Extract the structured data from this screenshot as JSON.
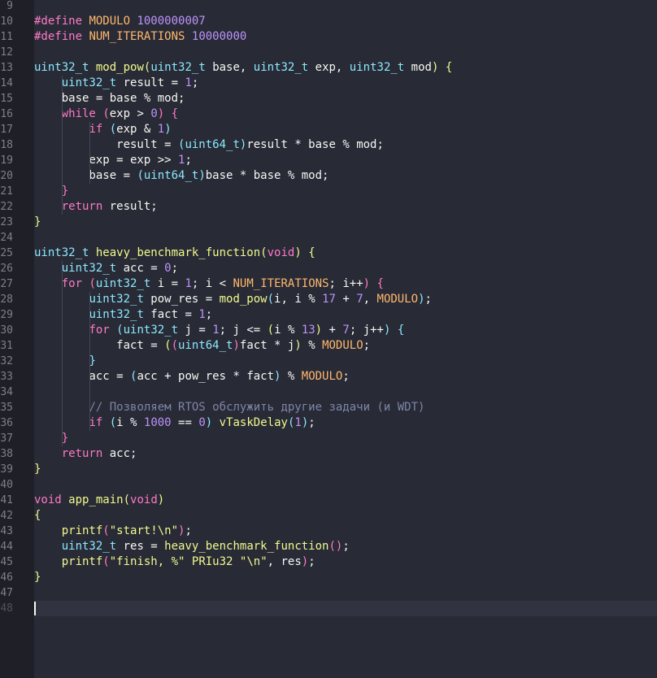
{
  "editor": {
    "lines": [
      {
        "num": "9",
        "tokens": []
      },
      {
        "num": "10",
        "tokens": [
          {
            "c": "t-pre",
            "t": "#define "
          },
          {
            "c": "t-macro",
            "t": "MODULO"
          },
          {
            "c": "t-plain",
            "t": " "
          },
          {
            "c": "t-num",
            "t": "1000000007"
          }
        ]
      },
      {
        "num": "11",
        "tokens": [
          {
            "c": "t-pre",
            "t": "#define "
          },
          {
            "c": "t-macro",
            "t": "NUM_ITERATIONS"
          },
          {
            "c": "t-plain",
            "t": " "
          },
          {
            "c": "t-num",
            "t": "10000000"
          }
        ]
      },
      {
        "num": "12",
        "tokens": []
      },
      {
        "num": "13",
        "tokens": [
          {
            "c": "t-type",
            "t": "uint32_t"
          },
          {
            "c": "t-plain",
            "t": " "
          },
          {
            "c": "t-fn",
            "t": "mod_pow"
          },
          {
            "c": "t-paren1",
            "t": "("
          },
          {
            "c": "t-type",
            "t": "uint32_t"
          },
          {
            "c": "t-plain",
            "t": " base, "
          },
          {
            "c": "t-type",
            "t": "uint32_t"
          },
          {
            "c": "t-plain",
            "t": " exp, "
          },
          {
            "c": "t-type",
            "t": "uint32_t"
          },
          {
            "c": "t-plain",
            "t": " mod"
          },
          {
            "c": "t-paren1",
            "t": ")"
          },
          {
            "c": "t-plain",
            "t": " "
          },
          {
            "c": "t-paren1",
            "t": "{"
          }
        ]
      },
      {
        "num": "14",
        "tokens": [
          {
            "c": "t-plain",
            "t": "    "
          },
          {
            "c": "t-type",
            "t": "uint32_t"
          },
          {
            "c": "t-plain",
            "t": " result = "
          },
          {
            "c": "t-num",
            "t": "1"
          },
          {
            "c": "t-plain",
            "t": ";"
          }
        ]
      },
      {
        "num": "15",
        "tokens": [
          {
            "c": "t-plain",
            "t": "    base = base % mod;"
          }
        ]
      },
      {
        "num": "16",
        "tokens": [
          {
            "c": "t-plain",
            "t": "    "
          },
          {
            "c": "t-kw",
            "t": "while"
          },
          {
            "c": "t-plain",
            "t": " "
          },
          {
            "c": "t-paren2",
            "t": "("
          },
          {
            "c": "t-plain",
            "t": "exp > "
          },
          {
            "c": "t-num",
            "t": "0"
          },
          {
            "c": "t-paren2",
            "t": ")"
          },
          {
            "c": "t-plain",
            "t": " "
          },
          {
            "c": "t-paren2",
            "t": "{"
          }
        ]
      },
      {
        "num": "17",
        "tokens": [
          {
            "c": "t-plain",
            "t": "        "
          },
          {
            "c": "t-kw",
            "t": "if"
          },
          {
            "c": "t-plain",
            "t": " "
          },
          {
            "c": "t-paren3",
            "t": "("
          },
          {
            "c": "t-plain",
            "t": "exp & "
          },
          {
            "c": "t-num",
            "t": "1"
          },
          {
            "c": "t-paren3",
            "t": ")"
          }
        ]
      },
      {
        "num": "18",
        "tokens": [
          {
            "c": "t-plain",
            "t": "            result = "
          },
          {
            "c": "t-paren3",
            "t": "("
          },
          {
            "c": "t-type",
            "t": "uint64_t"
          },
          {
            "c": "t-paren3",
            "t": ")"
          },
          {
            "c": "t-plain",
            "t": "result * base % mod;"
          }
        ]
      },
      {
        "num": "19",
        "tokens": [
          {
            "c": "t-plain",
            "t": "        exp = exp >> "
          },
          {
            "c": "t-num",
            "t": "1"
          },
          {
            "c": "t-plain",
            "t": ";"
          }
        ]
      },
      {
        "num": "20",
        "tokens": [
          {
            "c": "t-plain",
            "t": "        base = "
          },
          {
            "c": "t-paren3",
            "t": "("
          },
          {
            "c": "t-type",
            "t": "uint64_t"
          },
          {
            "c": "t-paren3",
            "t": ")"
          },
          {
            "c": "t-plain",
            "t": "base * base % mod;"
          }
        ]
      },
      {
        "num": "21",
        "tokens": [
          {
            "c": "t-plain",
            "t": "    "
          },
          {
            "c": "t-paren2",
            "t": "}"
          }
        ]
      },
      {
        "num": "22",
        "tokens": [
          {
            "c": "t-plain",
            "t": "    "
          },
          {
            "c": "t-kw",
            "t": "return"
          },
          {
            "c": "t-plain",
            "t": " result;"
          }
        ]
      },
      {
        "num": "23",
        "tokens": [
          {
            "c": "t-paren1",
            "t": "}"
          }
        ]
      },
      {
        "num": "24",
        "tokens": []
      },
      {
        "num": "25",
        "tokens": [
          {
            "c": "t-type",
            "t": "uint32_t"
          },
          {
            "c": "t-plain",
            "t": " "
          },
          {
            "c": "t-fn",
            "t": "heavy_benchmark_function"
          },
          {
            "c": "t-paren1",
            "t": "("
          },
          {
            "c": "t-kw",
            "t": "void"
          },
          {
            "c": "t-paren1",
            "t": ")"
          },
          {
            "c": "t-plain",
            "t": " "
          },
          {
            "c": "t-paren1",
            "t": "{"
          }
        ]
      },
      {
        "num": "26",
        "tokens": [
          {
            "c": "t-plain",
            "t": "    "
          },
          {
            "c": "t-type",
            "t": "uint32_t"
          },
          {
            "c": "t-plain",
            "t": " acc = "
          },
          {
            "c": "t-num",
            "t": "0"
          },
          {
            "c": "t-plain",
            "t": ";"
          }
        ]
      },
      {
        "num": "27",
        "tokens": [
          {
            "c": "t-plain",
            "t": "    "
          },
          {
            "c": "t-kw",
            "t": "for"
          },
          {
            "c": "t-plain",
            "t": " "
          },
          {
            "c": "t-paren2",
            "t": "("
          },
          {
            "c": "t-type",
            "t": "uint32_t"
          },
          {
            "c": "t-plain",
            "t": " i = "
          },
          {
            "c": "t-num",
            "t": "1"
          },
          {
            "c": "t-plain",
            "t": "; i < "
          },
          {
            "c": "t-macro",
            "t": "NUM_ITERATIONS"
          },
          {
            "c": "t-plain",
            "t": "; i++"
          },
          {
            "c": "t-paren2",
            "t": ")"
          },
          {
            "c": "t-plain",
            "t": " "
          },
          {
            "c": "t-paren2",
            "t": "{"
          }
        ]
      },
      {
        "num": "28",
        "tokens": [
          {
            "c": "t-plain",
            "t": "        "
          },
          {
            "c": "t-type",
            "t": "uint32_t"
          },
          {
            "c": "t-plain",
            "t": " pow_res = "
          },
          {
            "c": "t-fn",
            "t": "mod_pow"
          },
          {
            "c": "t-paren3",
            "t": "("
          },
          {
            "c": "t-plain",
            "t": "i, i % "
          },
          {
            "c": "t-num",
            "t": "17"
          },
          {
            "c": "t-plain",
            "t": " + "
          },
          {
            "c": "t-num",
            "t": "7"
          },
          {
            "c": "t-plain",
            "t": ", "
          },
          {
            "c": "t-macro",
            "t": "MODULO"
          },
          {
            "c": "t-paren3",
            "t": ")"
          },
          {
            "c": "t-plain",
            "t": ";"
          }
        ]
      },
      {
        "num": "29",
        "tokens": [
          {
            "c": "t-plain",
            "t": "        "
          },
          {
            "c": "t-type",
            "t": "uint32_t"
          },
          {
            "c": "t-plain",
            "t": " fact = "
          },
          {
            "c": "t-num",
            "t": "1"
          },
          {
            "c": "t-plain",
            "t": ";"
          }
        ]
      },
      {
        "num": "30",
        "tokens": [
          {
            "c": "t-plain",
            "t": "        "
          },
          {
            "c": "t-kw",
            "t": "for"
          },
          {
            "c": "t-plain",
            "t": " "
          },
          {
            "c": "t-paren3",
            "t": "("
          },
          {
            "c": "t-type",
            "t": "uint32_t"
          },
          {
            "c": "t-plain",
            "t": " j = "
          },
          {
            "c": "t-num",
            "t": "1"
          },
          {
            "c": "t-plain",
            "t": "; j <= "
          },
          {
            "c": "t-paren1",
            "t": "("
          },
          {
            "c": "t-plain",
            "t": "i % "
          },
          {
            "c": "t-num",
            "t": "13"
          },
          {
            "c": "t-paren1",
            "t": ")"
          },
          {
            "c": "t-plain",
            "t": " + "
          },
          {
            "c": "t-num",
            "t": "7"
          },
          {
            "c": "t-plain",
            "t": "; j++"
          },
          {
            "c": "t-paren3",
            "t": ")"
          },
          {
            "c": "t-plain",
            "t": " "
          },
          {
            "c": "t-paren3",
            "t": "{"
          }
        ]
      },
      {
        "num": "31",
        "tokens": [
          {
            "c": "t-plain",
            "t": "            fact = "
          },
          {
            "c": "t-paren1",
            "t": "("
          },
          {
            "c": "t-paren2",
            "t": "("
          },
          {
            "c": "t-type",
            "t": "uint64_t"
          },
          {
            "c": "t-paren2",
            "t": ")"
          },
          {
            "c": "t-plain",
            "t": "fact * j"
          },
          {
            "c": "t-paren1",
            "t": ")"
          },
          {
            "c": "t-plain",
            "t": " % "
          },
          {
            "c": "t-macro",
            "t": "MODULO"
          },
          {
            "c": "t-plain",
            "t": ";"
          }
        ]
      },
      {
        "num": "32",
        "tokens": [
          {
            "c": "t-plain",
            "t": "        "
          },
          {
            "c": "t-paren3",
            "t": "}"
          }
        ]
      },
      {
        "num": "33",
        "tokens": [
          {
            "c": "t-plain",
            "t": "        acc = "
          },
          {
            "c": "t-paren3",
            "t": "("
          },
          {
            "c": "t-plain",
            "t": "acc + pow_res * fact"
          },
          {
            "c": "t-paren3",
            "t": ")"
          },
          {
            "c": "t-plain",
            "t": " % "
          },
          {
            "c": "t-macro",
            "t": "MODULO"
          },
          {
            "c": "t-plain",
            "t": ";"
          }
        ]
      },
      {
        "num": "34",
        "tokens": []
      },
      {
        "num": "35",
        "tokens": [
          {
            "c": "t-plain",
            "t": "        "
          },
          {
            "c": "t-com",
            "t": "// Позволяем RTOS обслужить другие задачи (и WDT)"
          }
        ]
      },
      {
        "num": "36",
        "tokens": [
          {
            "c": "t-plain",
            "t": "        "
          },
          {
            "c": "t-kw",
            "t": "if"
          },
          {
            "c": "t-plain",
            "t": " "
          },
          {
            "c": "t-paren3",
            "t": "("
          },
          {
            "c": "t-plain",
            "t": "i % "
          },
          {
            "c": "t-num",
            "t": "1000"
          },
          {
            "c": "t-plain",
            "t": " == "
          },
          {
            "c": "t-num",
            "t": "0"
          },
          {
            "c": "t-paren3",
            "t": ")"
          },
          {
            "c": "t-plain",
            "t": " "
          },
          {
            "c": "t-fn",
            "t": "vTaskDelay"
          },
          {
            "c": "t-paren3",
            "t": "("
          },
          {
            "c": "t-num",
            "t": "1"
          },
          {
            "c": "t-paren3",
            "t": ")"
          },
          {
            "c": "t-plain",
            "t": ";"
          }
        ]
      },
      {
        "num": "37",
        "tokens": [
          {
            "c": "t-plain",
            "t": "    "
          },
          {
            "c": "t-paren2",
            "t": "}"
          }
        ]
      },
      {
        "num": "38",
        "tokens": [
          {
            "c": "t-plain",
            "t": "    "
          },
          {
            "c": "t-kw",
            "t": "return"
          },
          {
            "c": "t-plain",
            "t": " acc;"
          }
        ]
      },
      {
        "num": "39",
        "tokens": [
          {
            "c": "t-paren1",
            "t": "}"
          }
        ]
      },
      {
        "num": "40",
        "tokens": []
      },
      {
        "num": "41",
        "tokens": [
          {
            "c": "t-kw",
            "t": "void"
          },
          {
            "c": "t-plain",
            "t": " "
          },
          {
            "c": "t-fn",
            "t": "app_main"
          },
          {
            "c": "t-paren1",
            "t": "("
          },
          {
            "c": "t-kw",
            "t": "void"
          },
          {
            "c": "t-paren1",
            "t": ")"
          }
        ]
      },
      {
        "num": "42",
        "tokens": [
          {
            "c": "t-paren1",
            "t": "{"
          }
        ]
      },
      {
        "num": "43",
        "tokens": [
          {
            "c": "t-plain",
            "t": "    "
          },
          {
            "c": "t-fn",
            "t": "printf"
          },
          {
            "c": "t-paren2",
            "t": "("
          },
          {
            "c": "t-str",
            "t": "\"start!\\n\""
          },
          {
            "c": "t-paren2",
            "t": ")"
          },
          {
            "c": "t-plain",
            "t": ";"
          }
        ]
      },
      {
        "num": "44",
        "tokens": [
          {
            "c": "t-plain",
            "t": "    "
          },
          {
            "c": "t-type",
            "t": "uint32_t"
          },
          {
            "c": "t-plain",
            "t": " res = "
          },
          {
            "c": "t-fn",
            "t": "heavy_benchmark_function"
          },
          {
            "c": "t-paren2",
            "t": "()"
          },
          {
            "c": "t-plain",
            "t": ";"
          }
        ]
      },
      {
        "num": "45",
        "tokens": [
          {
            "c": "t-plain",
            "t": "    "
          },
          {
            "c": "t-fn",
            "t": "printf"
          },
          {
            "c": "t-paren2",
            "t": "("
          },
          {
            "c": "t-str",
            "t": "\"finish, %\""
          },
          {
            "c": "t-plain",
            "t": " "
          },
          {
            "c": "t-fn",
            "t": "PRIu32"
          },
          {
            "c": "t-plain",
            "t": " "
          },
          {
            "c": "t-str",
            "t": "\"\\n\""
          },
          {
            "c": "t-plain",
            "t": ", res"
          },
          {
            "c": "t-paren2",
            "t": ")"
          },
          {
            "c": "t-plain",
            "t": ";"
          }
        ]
      },
      {
        "num": "46",
        "tokens": [
          {
            "c": "t-paren1",
            "t": "}"
          }
        ]
      },
      {
        "num": "47",
        "tokens": []
      },
      {
        "num": "48",
        "tokens": [],
        "dim": true
      }
    ],
    "current_line": "48"
  }
}
